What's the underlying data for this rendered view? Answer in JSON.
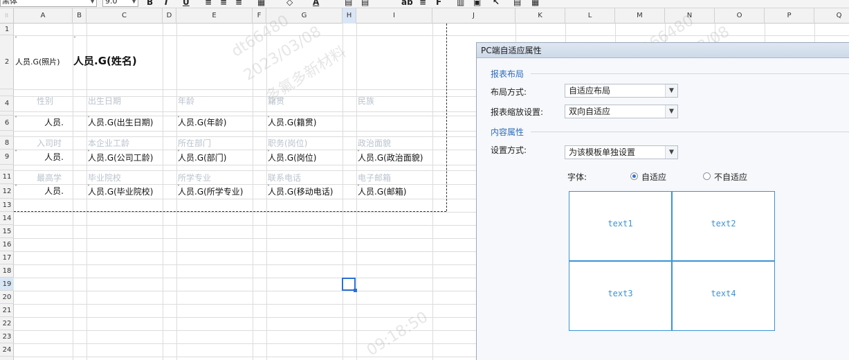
{
  "toolbar": {
    "font_name": "黑体",
    "font_size": "9.0",
    "bold": "B",
    "italic": "I",
    "underline": "U",
    "font_color": "A"
  },
  "columns": [
    "A",
    "B",
    "C",
    "D",
    "E",
    "F",
    "G",
    "H",
    "I",
    "J",
    "K",
    "L",
    "M",
    "N",
    "O",
    "P",
    "Q"
  ],
  "rows": [
    "1",
    "2",
    "4",
    "6",
    "8",
    "9",
    "11",
    "12",
    "13",
    "14",
    "15",
    "16",
    "17",
    "18",
    "19",
    "20",
    "21",
    "22",
    "23",
    "24"
  ],
  "sheet": {
    "r2": {
      "photo": "人员.G(照片)",
      "name": "人员.G(姓名)"
    },
    "r4": {
      "a": "性别",
      "c": "出生日期",
      "e": "年龄",
      "g": "籍贯",
      "i": "民族"
    },
    "r6": {
      "a": "人员.",
      "c": "人员.G(出生日期)",
      "e": "人员.G(年龄)",
      "g": "人员.G(籍贯)"
    },
    "r8": {
      "a": "入司时",
      "c": "本企业工龄",
      "e": "所在部门",
      "g": "职务(岗位)",
      "i": "政治面貌"
    },
    "r9": {
      "a": "人员.",
      "c": "人员.G(公司工龄)",
      "e": "人员.G(部门)",
      "g": "人员.G(岗位)",
      "i": "人员.G(政治面貌)"
    },
    "r11": {
      "a": "最高学",
      "c": "毕业院校",
      "e": "所学专业",
      "g": "联系电话",
      "i": "电子邮箱"
    },
    "r12": {
      "a": "人员.",
      "c": "人员.G(毕业院校)",
      "e": "人员.G(所学专业)",
      "g": "人员.G(移动电话)",
      "i": "人员.G(邮箱)"
    }
  },
  "watermark": {
    "line1": "dt66480",
    "line2": "2023/03/08",
    "line3": "多氟多新材料",
    "time": "09:18:50"
  },
  "panel": {
    "title": "PC端自适应属性",
    "section_layout": "报表布局",
    "layout_mode_label": "布局方式:",
    "layout_mode_value": "自适应布局",
    "scale_label": "报表缩放设置:",
    "scale_value": "双向自适应",
    "section_content": "内容属性",
    "setting_label": "设置方式:",
    "setting_value": "为该模板单独设置",
    "font_label": "字体:",
    "radio_adaptive": "自适应",
    "radio_not_adaptive": "不自适应",
    "preview": [
      "text1",
      "text2",
      "text3",
      "text4"
    ]
  },
  "colors": {
    "accent": "#2e6bb8",
    "preview_border": "#3a93d6",
    "label_gray": "#b9c3cd"
  }
}
